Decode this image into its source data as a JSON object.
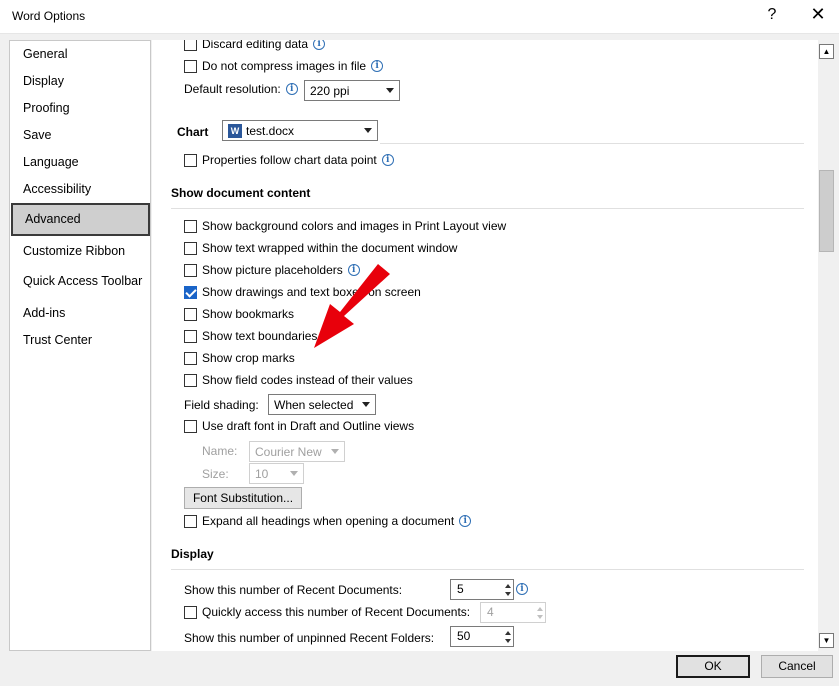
{
  "window": {
    "title": "Word Options",
    "help": "?",
    "close": "✕"
  },
  "nav": {
    "items": [
      "General",
      "Display",
      "Proofing",
      "Save",
      "Language",
      "Accessibility",
      "Advanced",
      "Customize Ribbon",
      "Quick Access Toolbar",
      "Add-ins",
      "Trust Center"
    ],
    "active": "Advanced"
  },
  "image_size": {
    "discard_editing_data": "Discard editing data",
    "do_not_compress": "Do not compress images in file",
    "default_resolution_label": "Default resolution:",
    "default_resolution_value": "220 ppi"
  },
  "chart": {
    "heading": "Chart",
    "file_value": "test.docx",
    "file_icon": "W",
    "properties_follow": "Properties follow chart data point"
  },
  "show_document_content": {
    "heading": "Show document content",
    "options": [
      {
        "label": "Show background colors and images in Print Layout view",
        "checked": false
      },
      {
        "label": "Show text wrapped within the document window",
        "checked": false
      },
      {
        "label": "Show picture placeholders",
        "checked": false
      },
      {
        "label": "Show drawings and text boxes on screen",
        "checked": true
      },
      {
        "label": "Show bookmarks",
        "checked": false
      },
      {
        "label": "Show text boundaries",
        "checked": false
      },
      {
        "label": "Show crop marks",
        "checked": false
      },
      {
        "label": "Show field codes instead of their values",
        "checked": false
      }
    ],
    "field_shading_label": "Field shading:",
    "field_shading_value": "When selected",
    "use_draft_font": "Use draft font in Draft and Outline views",
    "name_label": "Name:",
    "name_value": "Courier New",
    "size_label": "Size:",
    "size_value": "10",
    "font_substitution": "Font Substitution...",
    "expand_headings": "Expand all headings when opening a document"
  },
  "display": {
    "heading": "Display",
    "recent_docs_label": "Show this number of Recent Documents:",
    "recent_docs_value": "5",
    "quick_access_label": "Quickly access this number of Recent Documents:",
    "quick_access_value": "4",
    "recent_folders_label": "Show this number of unpinned Recent Folders:",
    "recent_folders_value": "50"
  },
  "footer": {
    "ok": "OK",
    "cancel": "Cancel"
  },
  "colors": {
    "arrow": "#e8000b",
    "checkbox_checked": "#1a64c8",
    "info_icon": "#2f6fb5"
  }
}
